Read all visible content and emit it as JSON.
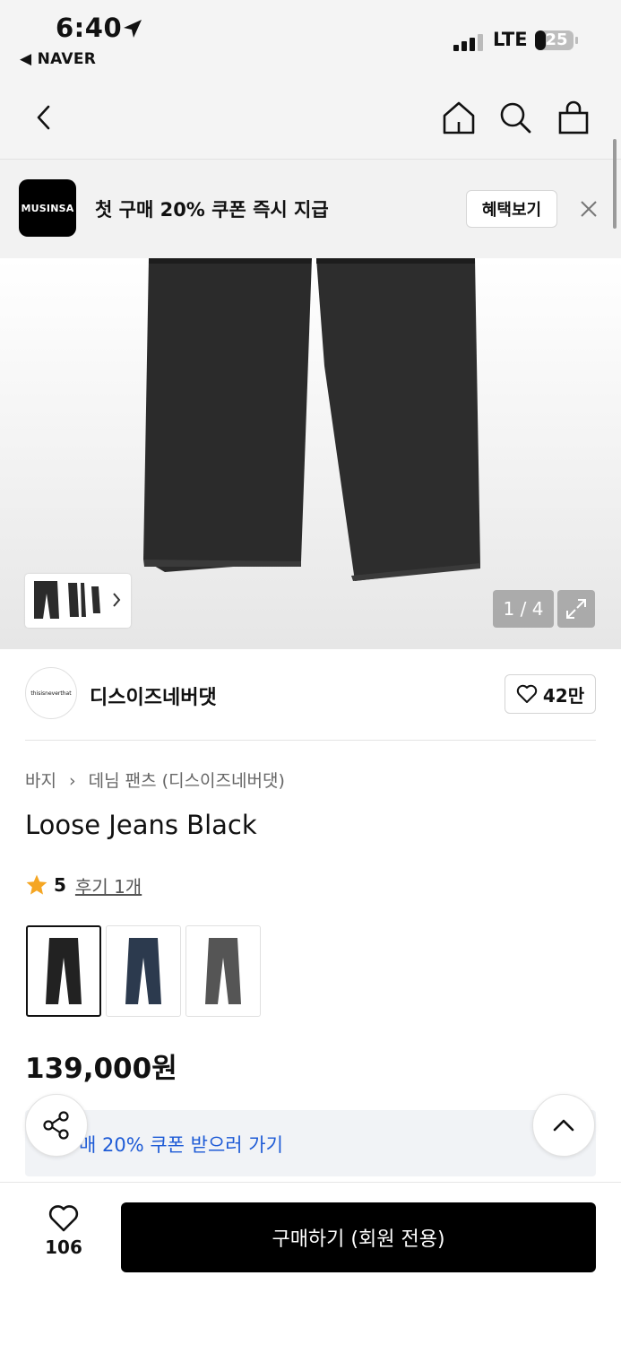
{
  "status_bar": {
    "time": "6:40",
    "back_app": "◀ NAVER",
    "network": "LTE",
    "battery": "25"
  },
  "nav": {
    "icons": [
      "back-icon",
      "home-icon",
      "search-icon",
      "shopping-bag-icon"
    ]
  },
  "banner": {
    "logo_text": "MUSINSA",
    "text": "첫 구매 20% 쿠폰 즉시 지급",
    "button": "혜택보기"
  },
  "hero": {
    "page_indicator": "1 / 4",
    "image_color": "#2b2b2b"
  },
  "brand": {
    "logo_text": "thisisneverthat",
    "name": "디스이즈네버댓",
    "likes": "42만"
  },
  "breadcrumb": {
    "items": [
      "바지",
      "데님 팬츠 (디스이즈네버댓)"
    ]
  },
  "product": {
    "title": "Loose Jeans Black",
    "rating": "5",
    "review_link": "후기 1개",
    "price": "139,000원",
    "colors": [
      {
        "name": "black",
        "hex": "#222222"
      },
      {
        "name": "navy",
        "hex": "#2c3a4e"
      },
      {
        "name": "grey",
        "hex": "#555555"
      }
    ]
  },
  "coupon": {
    "text": "매 20% 쿠폰 받으러 가기"
  },
  "bottom": {
    "wish_count": "106",
    "buy_label": "구매하기 (회원 전용)"
  },
  "colors": {
    "accent_blue": "#1e5bd6",
    "star": "#f5a623",
    "buy_button": "#000000"
  }
}
